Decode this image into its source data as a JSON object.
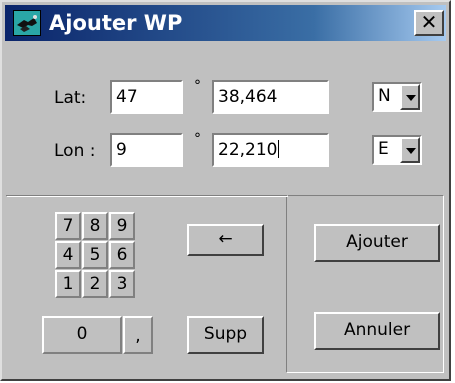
{
  "window": {
    "title": "Ajouter WP",
    "close_label": "✕"
  },
  "lat": {
    "label": "Lat:",
    "degrees": "47",
    "minutes": "38,464",
    "degree_symbol": "°",
    "hemisphere": "N"
  },
  "lon": {
    "label": "Lon :",
    "degrees": "9",
    "minutes": "22,210",
    "degree_symbol": "°",
    "hemisphere": "E"
  },
  "keypad": {
    "keys": [
      "7",
      "8",
      "9",
      "4",
      "5",
      "6",
      "1",
      "2",
      "3",
      "0",
      ","
    ]
  },
  "buttons": {
    "backspace": "←",
    "delete": "Supp",
    "add": "Ajouter",
    "cancel": "Annuler"
  },
  "colors": {
    "title_gradient_start": "#0a246a",
    "title_gradient_end": "#a6caf0",
    "face": "#c0c0c0"
  }
}
